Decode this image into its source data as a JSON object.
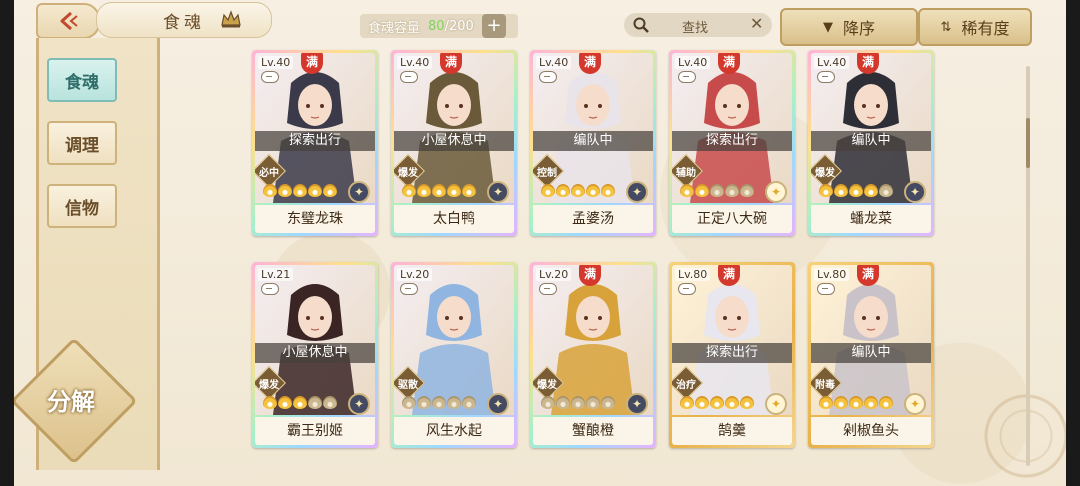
{
  "header": {
    "title": "食魂",
    "capacity_label": "食魂容量",
    "capacity_current": "80",
    "capacity_max": "/200",
    "capacity_plus": "+",
    "search_placeholder": "查找",
    "sort_desc_label": "降序",
    "sort_rarity_label": "稀有度"
  },
  "sidebar": {
    "items": [
      {
        "label": "食魂",
        "active": true
      },
      {
        "label": "调理",
        "active": false
      },
      {
        "label": "信物",
        "active": false
      }
    ],
    "decompose_label": "分解"
  },
  "cards": [
    {
      "level": "Lv.40",
      "full_mark": "满",
      "status": "探索出行",
      "role": "必中",
      "name": "东璧龙珠",
      "flames": 5,
      "badge": "dark",
      "frame": "rainbow",
      "hue": "#3b3a4a"
    },
    {
      "level": "Lv.40",
      "full_mark": "满",
      "status": "小屋休息中",
      "role": "爆发",
      "name": "太白鸭",
      "flames": 5,
      "badge": "dark",
      "frame": "rainbow",
      "hue": "#6a5a3a"
    },
    {
      "level": "Lv.40",
      "full_mark": "满",
      "status": "编队中",
      "role": "控制",
      "name": "孟婆汤",
      "flames": 5,
      "badge": "dark",
      "frame": "rainbow",
      "hue": "#e9e4ea"
    },
    {
      "level": "Lv.40",
      "full_mark": "满",
      "status": "探索出行",
      "role": "辅助",
      "name": "正定八大碗",
      "flames": 2,
      "badge": "light",
      "frame": "rainbow",
      "hue": "#c84b4b"
    },
    {
      "level": "Lv.40",
      "full_mark": "满",
      "status": "编队中",
      "role": "爆发",
      "name": "蟠龙菜",
      "flames": 4,
      "badge": "dark",
      "frame": "rainbow",
      "hue": "#2e2e36"
    },
    {
      "level": "Lv.21",
      "full_mark": "",
      "status": "小屋休息中",
      "role": "爆发",
      "name": "霸王别姬",
      "flames": 3,
      "badge": "dark",
      "frame": "rainbow",
      "hue": "#3a2424"
    },
    {
      "level": "Lv.20",
      "full_mark": "",
      "status": "",
      "role": "驱散",
      "name": "风生水起",
      "flames": 0,
      "badge": "dark",
      "frame": "rainbow",
      "hue": "#8fb5e0"
    },
    {
      "level": "Lv.20",
      "full_mark": "满",
      "status": "",
      "role": "爆发",
      "name": "蟹酿橙",
      "flames": 0,
      "badge": "dark",
      "frame": "rainbow",
      "hue": "#d8a23a"
    },
    {
      "level": "Lv.80",
      "full_mark": "满",
      "status": "探索出行",
      "role": "治疗",
      "name": "鹄羹",
      "flames": 5,
      "badge": "light",
      "frame": "gold",
      "hue": "#e8e6ee"
    },
    {
      "level": "Lv.80",
      "full_mark": "满",
      "status": "编队中",
      "role": "附毒",
      "name": "剁椒鱼头",
      "flames": 5,
      "badge": "light",
      "frame": "gold",
      "hue": "#c9c3c9"
    }
  ]
}
